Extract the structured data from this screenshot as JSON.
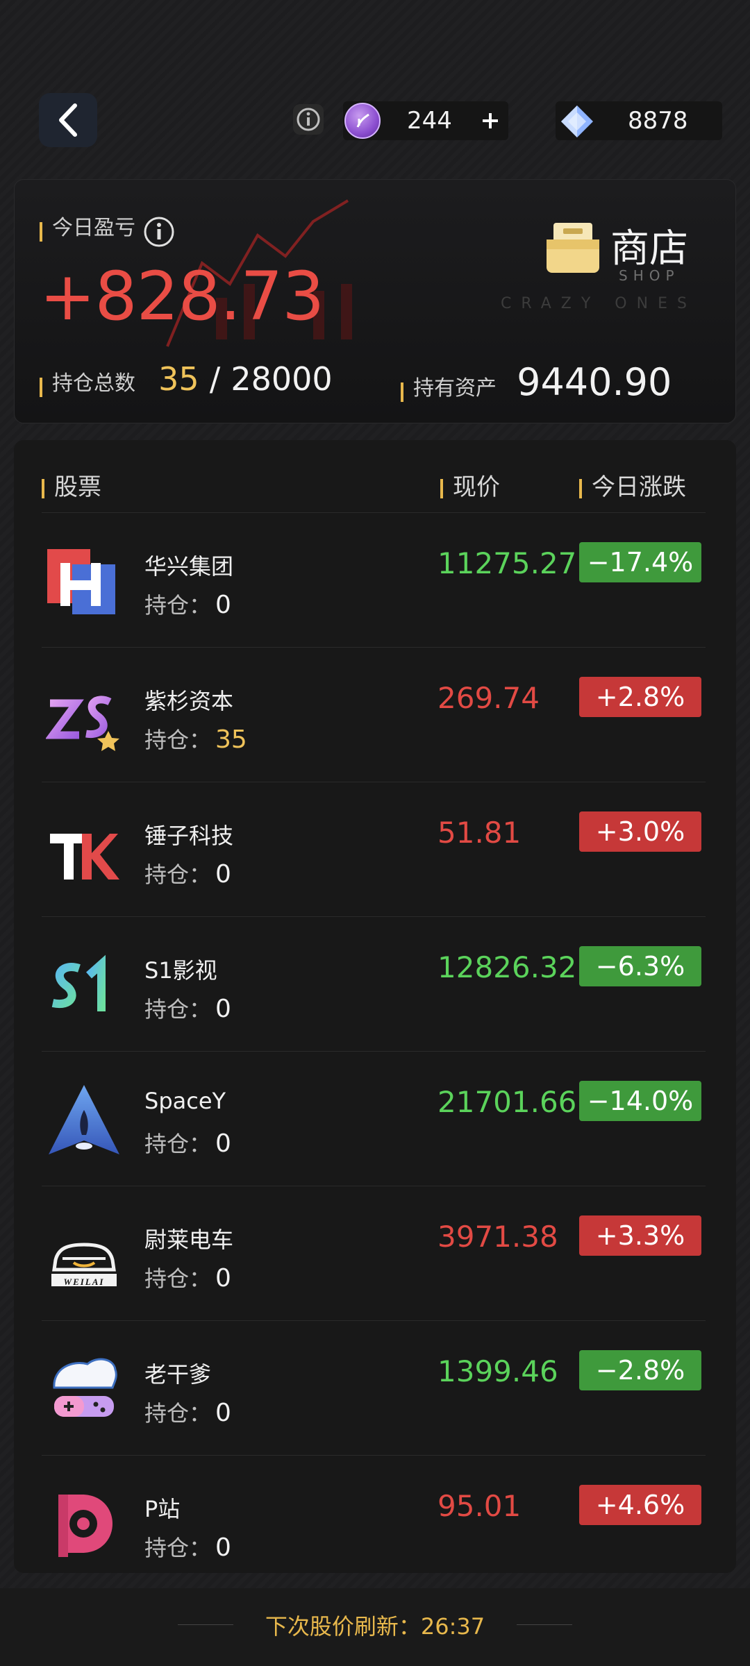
{
  "topbar": {
    "coin_value": "244",
    "gem_value": "8878"
  },
  "summary": {
    "pnl_label": "今日盈亏",
    "pnl_value": "+828.73",
    "shop_title": "商店",
    "shop_sub": "SHOP",
    "watermark": "CRAZY ONES",
    "holdings_label": "持仓总数",
    "holdings_count": "35",
    "holdings_sep": "/",
    "holdings_total": "28000",
    "assets_label": "持有资产",
    "assets_value": "9440.90"
  },
  "list": {
    "col_stock": "股票",
    "col_price": "现价",
    "col_change": "今日涨跌",
    "hold_label": "持仓：",
    "stocks": [
      {
        "name": "华兴集团",
        "holding": "0",
        "price": "11275.27",
        "change": "−17.4%",
        "dir": "down",
        "logo": "huaxing-logo"
      },
      {
        "name": "紫杉资本",
        "holding": "35",
        "price": "269.74",
        "change": "+2.8%",
        "dir": "up",
        "logo": "zs-logo"
      },
      {
        "name": "锤子科技",
        "holding": "0",
        "price": "51.81",
        "change": "+3.0%",
        "dir": "up",
        "logo": "hammer-logo"
      },
      {
        "name": "S1影视",
        "holding": "0",
        "price": "12826.32",
        "change": "−6.3%",
        "dir": "down",
        "logo": "s1-logo"
      },
      {
        "name": "SpaceY",
        "holding": "0",
        "price": "21701.66",
        "change": "−14.0%",
        "dir": "down",
        "logo": "rocket-logo"
      },
      {
        "name": "尉莱电车",
        "holding": "0",
        "price": "3971.38",
        "change": "+3.3%",
        "dir": "up",
        "logo": "weilai-logo",
        "logo_text": "WEILAI"
      },
      {
        "name": "老干爹",
        "holding": "0",
        "price": "1399.46",
        "change": "−2.8%",
        "dir": "down",
        "logo": "gamer-logo"
      },
      {
        "name": "P站",
        "holding": "0",
        "price": "95.01",
        "change": "+4.6%",
        "dir": "up",
        "logo": "p-logo"
      }
    ]
  },
  "footer": {
    "refresh_label": "下次股价刷新：",
    "refresh_time": "26:37"
  },
  "colors": {
    "up": "#e24a44",
    "down": "#5bd35b",
    "accent": "#e8b84c"
  }
}
